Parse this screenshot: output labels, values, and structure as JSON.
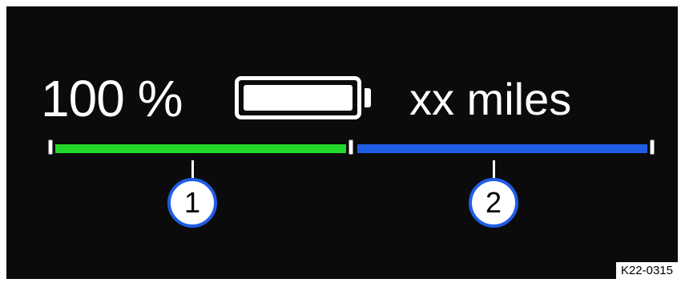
{
  "display": {
    "state_of_charge": "100 %",
    "battery_level": 1.0,
    "range": "xx miles"
  },
  "bars": {
    "charge_bar_color": "#22d82a",
    "range_bar_color": "#1f5de5"
  },
  "callouts": [
    "1",
    "2"
  ],
  "reference_code": "K22-0315"
}
